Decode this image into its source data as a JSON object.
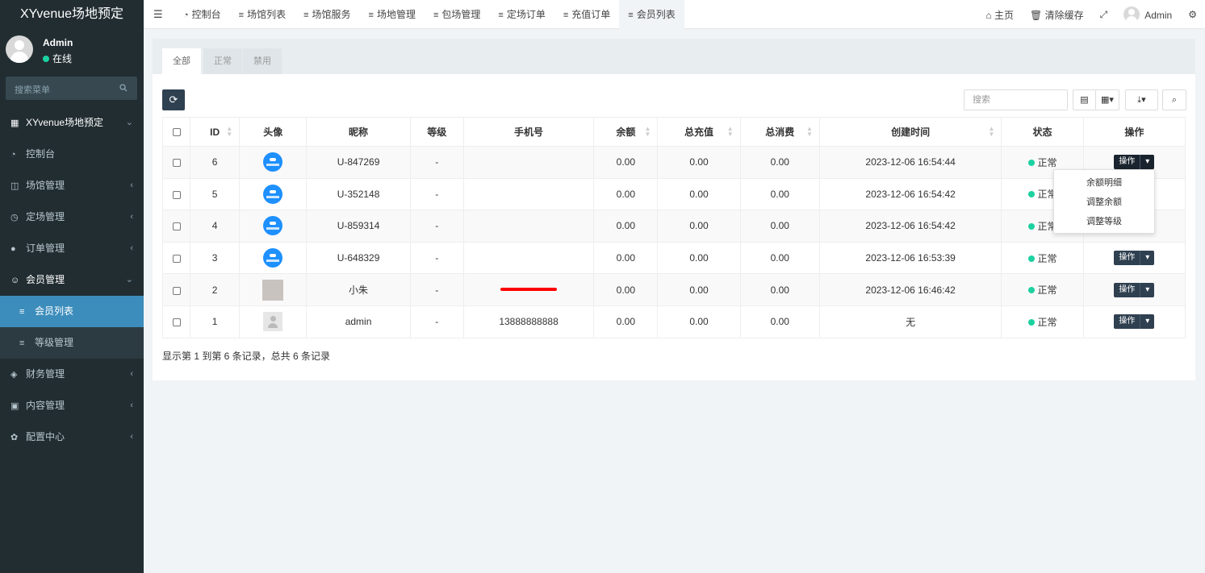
{
  "sidebar": {
    "brand": "XYvenue场地预定",
    "user": {
      "name": "Admin",
      "status": "在线"
    },
    "search_placeholder": "搜索菜单",
    "items": [
      {
        "icon": "grid-icon",
        "label": "XYvenue场地预定",
        "chevron": "⌄"
      },
      {
        "icon": "dashboard-icon",
        "label": "控制台"
      },
      {
        "icon": "columns-icon",
        "label": "场馆管理",
        "chevron": "‹"
      },
      {
        "icon": "clock-icon",
        "label": "定场管理",
        "chevron": "‹"
      },
      {
        "icon": "order-icon",
        "label": "订单管理",
        "chevron": "‹"
      },
      {
        "icon": "user-circle-icon",
        "label": "会员管理",
        "chevron": "⌄"
      },
      {
        "icon": "list-icon",
        "label": "会员列表"
      },
      {
        "icon": "list-icon",
        "label": "等级管理"
      },
      {
        "icon": "diamond-icon",
        "label": "财务管理",
        "chevron": "‹"
      },
      {
        "icon": "edit-icon",
        "label": "内容管理",
        "chevron": "‹"
      },
      {
        "icon": "gear-icon",
        "label": "配置中心",
        "chevron": "‹"
      }
    ]
  },
  "topnav": {
    "tabs": [
      {
        "icon": "dashboard-icon",
        "label": "控制台"
      },
      {
        "icon": "list-icon",
        "label": "场馆列表"
      },
      {
        "icon": "list-icon",
        "label": "场馆服务"
      },
      {
        "icon": "list-icon",
        "label": "场地管理"
      },
      {
        "icon": "list-icon",
        "label": "包场管理"
      },
      {
        "icon": "list-icon",
        "label": "定场订单"
      },
      {
        "icon": "list-icon",
        "label": "充值订单"
      },
      {
        "icon": "list-icon",
        "label": "会员列表"
      }
    ],
    "right": {
      "home": "主页",
      "clear_cache": "清除缓存",
      "user": "Admin"
    }
  },
  "panel": {
    "tabs": [
      "全部",
      "正常",
      "禁用"
    ],
    "search_placeholder": "搜索",
    "columns": [
      "ID",
      "头像",
      "昵称",
      "等级",
      "手机号",
      "余额",
      "总充值",
      "总消费",
      "创建时间",
      "状态",
      "操作"
    ],
    "rows": [
      {
        "id": "6",
        "avatar": "logo",
        "nickname": "U-847269",
        "level": "-",
        "phone": "",
        "balance": "0.00",
        "recharge": "0.00",
        "spend": "0.00",
        "created": "2023-12-06 16:54:44",
        "status": "正常",
        "op": "操作"
      },
      {
        "id": "5",
        "avatar": "logo",
        "nickname": "U-352148",
        "level": "-",
        "phone": "",
        "balance": "0.00",
        "recharge": "0.00",
        "spend": "0.00",
        "created": "2023-12-06 16:54:42",
        "status": "正常",
        "op": "操作"
      },
      {
        "id": "4",
        "avatar": "logo",
        "nickname": "U-859314",
        "level": "-",
        "phone": "",
        "balance": "0.00",
        "recharge": "0.00",
        "spend": "0.00",
        "created": "2023-12-06 16:54:42",
        "status": "正常",
        "op": "操作"
      },
      {
        "id": "3",
        "avatar": "logo",
        "nickname": "U-648329",
        "level": "-",
        "phone": "",
        "balance": "0.00",
        "recharge": "0.00",
        "spend": "0.00",
        "created": "2023-12-06 16:53:39",
        "status": "正常",
        "op": "操作"
      },
      {
        "id": "2",
        "avatar": "blur",
        "nickname": "小朱",
        "level": "-",
        "phone": "redacted",
        "balance": "0.00",
        "recharge": "0.00",
        "spend": "0.00",
        "created": "2023-12-06 16:46:42",
        "status": "正常",
        "op": "操作"
      },
      {
        "id": "1",
        "avatar": "default",
        "nickname": "admin",
        "level": "-",
        "phone": "13888888888",
        "balance": "0.00",
        "recharge": "0.00",
        "spend": "0.00",
        "created": "无",
        "status": "正常",
        "op": "操作"
      }
    ],
    "footer": "显示第 1 到第 6 条记录，总共 6 条记录",
    "dropdown": [
      "余额明细",
      "调整余额",
      "调整等级"
    ]
  },
  "colors": {
    "sidebar_bg": "#222d32",
    "active": "#3c8dbc",
    "status_ok": "#1dd1a1",
    "button_dark": "#2f4050"
  }
}
